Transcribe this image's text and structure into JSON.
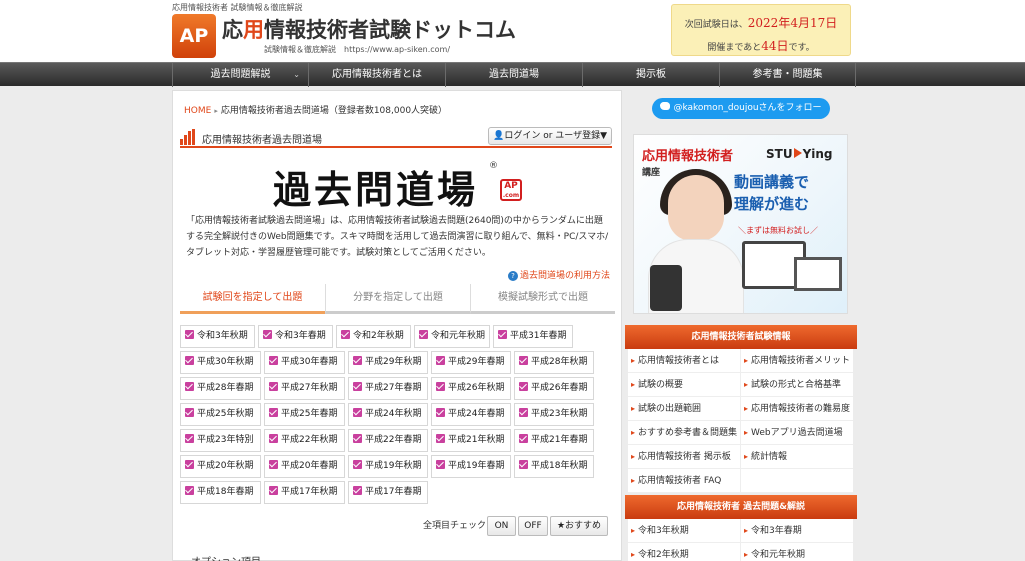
{
  "header": {
    "site_desc": "応用情報技術者 試験情報＆徹底解説",
    "logo_mark": "AP",
    "title_prefix": "応",
    "title_accent": "用",
    "title_rest": "情報技術者試験ドットコム",
    "subtitle": "試験情報＆徹底解説　https://www.ap-siken.com/",
    "next_exam": {
      "line1_prefix": "次回試験日は、",
      "date": "2022年4月17日",
      "line2_prefix": "開催まであと",
      "days": "44日",
      "line2_suffix": "です。"
    }
  },
  "nav": [
    {
      "label": "過去問題解説",
      "caret": "⌄"
    },
    {
      "label": "応用情報技術者とは"
    },
    {
      "label": "過去問道場"
    },
    {
      "label": "掲示板"
    },
    {
      "label": "参考書・問題集"
    }
  ],
  "breadcrumb": {
    "home": "HOME",
    "sep": "▸",
    "current": "応用情報技術者過去問道場（登録者数108,000人突破）"
  },
  "section": {
    "title": "応用情報技術者過去問道場",
    "login": "ログイン or ユーザ登録▼"
  },
  "dojo": {
    "big_title": "過去問道場",
    "reg": "®",
    "badge_top": "AP",
    "badge_bottom": ".com",
    "description": "「応用情報技術者試験過去問道場」は、応用情報技術者試験過去問題(2640問)の中からランダムに出題する完全解説付きのWeb問題集です。スキマ時間を活用して過去問演習に取り組んで、無料・PC/スマホ/タブレット対応・学習履歴管理可能です。試験対策としてご活用ください。",
    "usage_q": "?",
    "usage_link": "過去問道場の利用方法"
  },
  "tabs": [
    "試験回を指定して出題",
    "分野を指定して出題",
    "模擬試験形式で出題"
  ],
  "exam_options": [
    "令和3年秋期",
    "令和3年春期",
    "令和2年秋期",
    "令和元年秋期",
    "平成31年春期",
    "平成30年秋期",
    "平成30年春期",
    "平成29年秋期",
    "平成29年春期",
    "平成28年秋期",
    "平成28年春期",
    "平成27年秋期",
    "平成27年春期",
    "平成26年秋期",
    "平成26年春期",
    "平成25年秋期",
    "平成25年春期",
    "平成24年秋期",
    "平成24年春期",
    "平成23年秋期",
    "平成23年特別",
    "平成22年秋期",
    "平成22年春期",
    "平成21年秋期",
    "平成21年春期",
    "平成20年秋期",
    "平成20年春期",
    "平成19年秋期",
    "平成19年春期",
    "平成18年秋期",
    "平成18年春期",
    "平成17年秋期",
    "平成17年春期"
  ],
  "check_all": {
    "label": "全項目チェック",
    "on": "ON",
    "off": "OFF",
    "recommend": "★おすすめ"
  },
  "options_title": "オプション項目",
  "sidebar": {
    "follow": "@kakomon_doujouさんをフォロー",
    "ad": {
      "title": "応用情報技術者",
      "course": "講座",
      "brand_pre": "STU",
      "brand_post": "Ying",
      "line1": "動画講義で",
      "line2": "理解が進む",
      "free": "＼まずは無料お試し／"
    },
    "info_head": "応用情報技術者試験情報",
    "info_items": [
      "応用情報技術者とは",
      "応用情報技術者メリット",
      "試験の概要",
      "試験の形式と合格基準",
      "試験の出題範囲",
      "応用情報技術者の難易度",
      "おすすめ参考書＆問題集",
      "Webアプリ過去問道場",
      "応用情報技術者 掲示板",
      "統計情報",
      "応用情報技術者 FAQ",
      ""
    ],
    "past_head": "応用情報技術者 過去問題&解説",
    "past_items": [
      "令和3年秋期",
      "令和3年春期",
      "令和2年秋期",
      "令和元年秋期"
    ]
  }
}
